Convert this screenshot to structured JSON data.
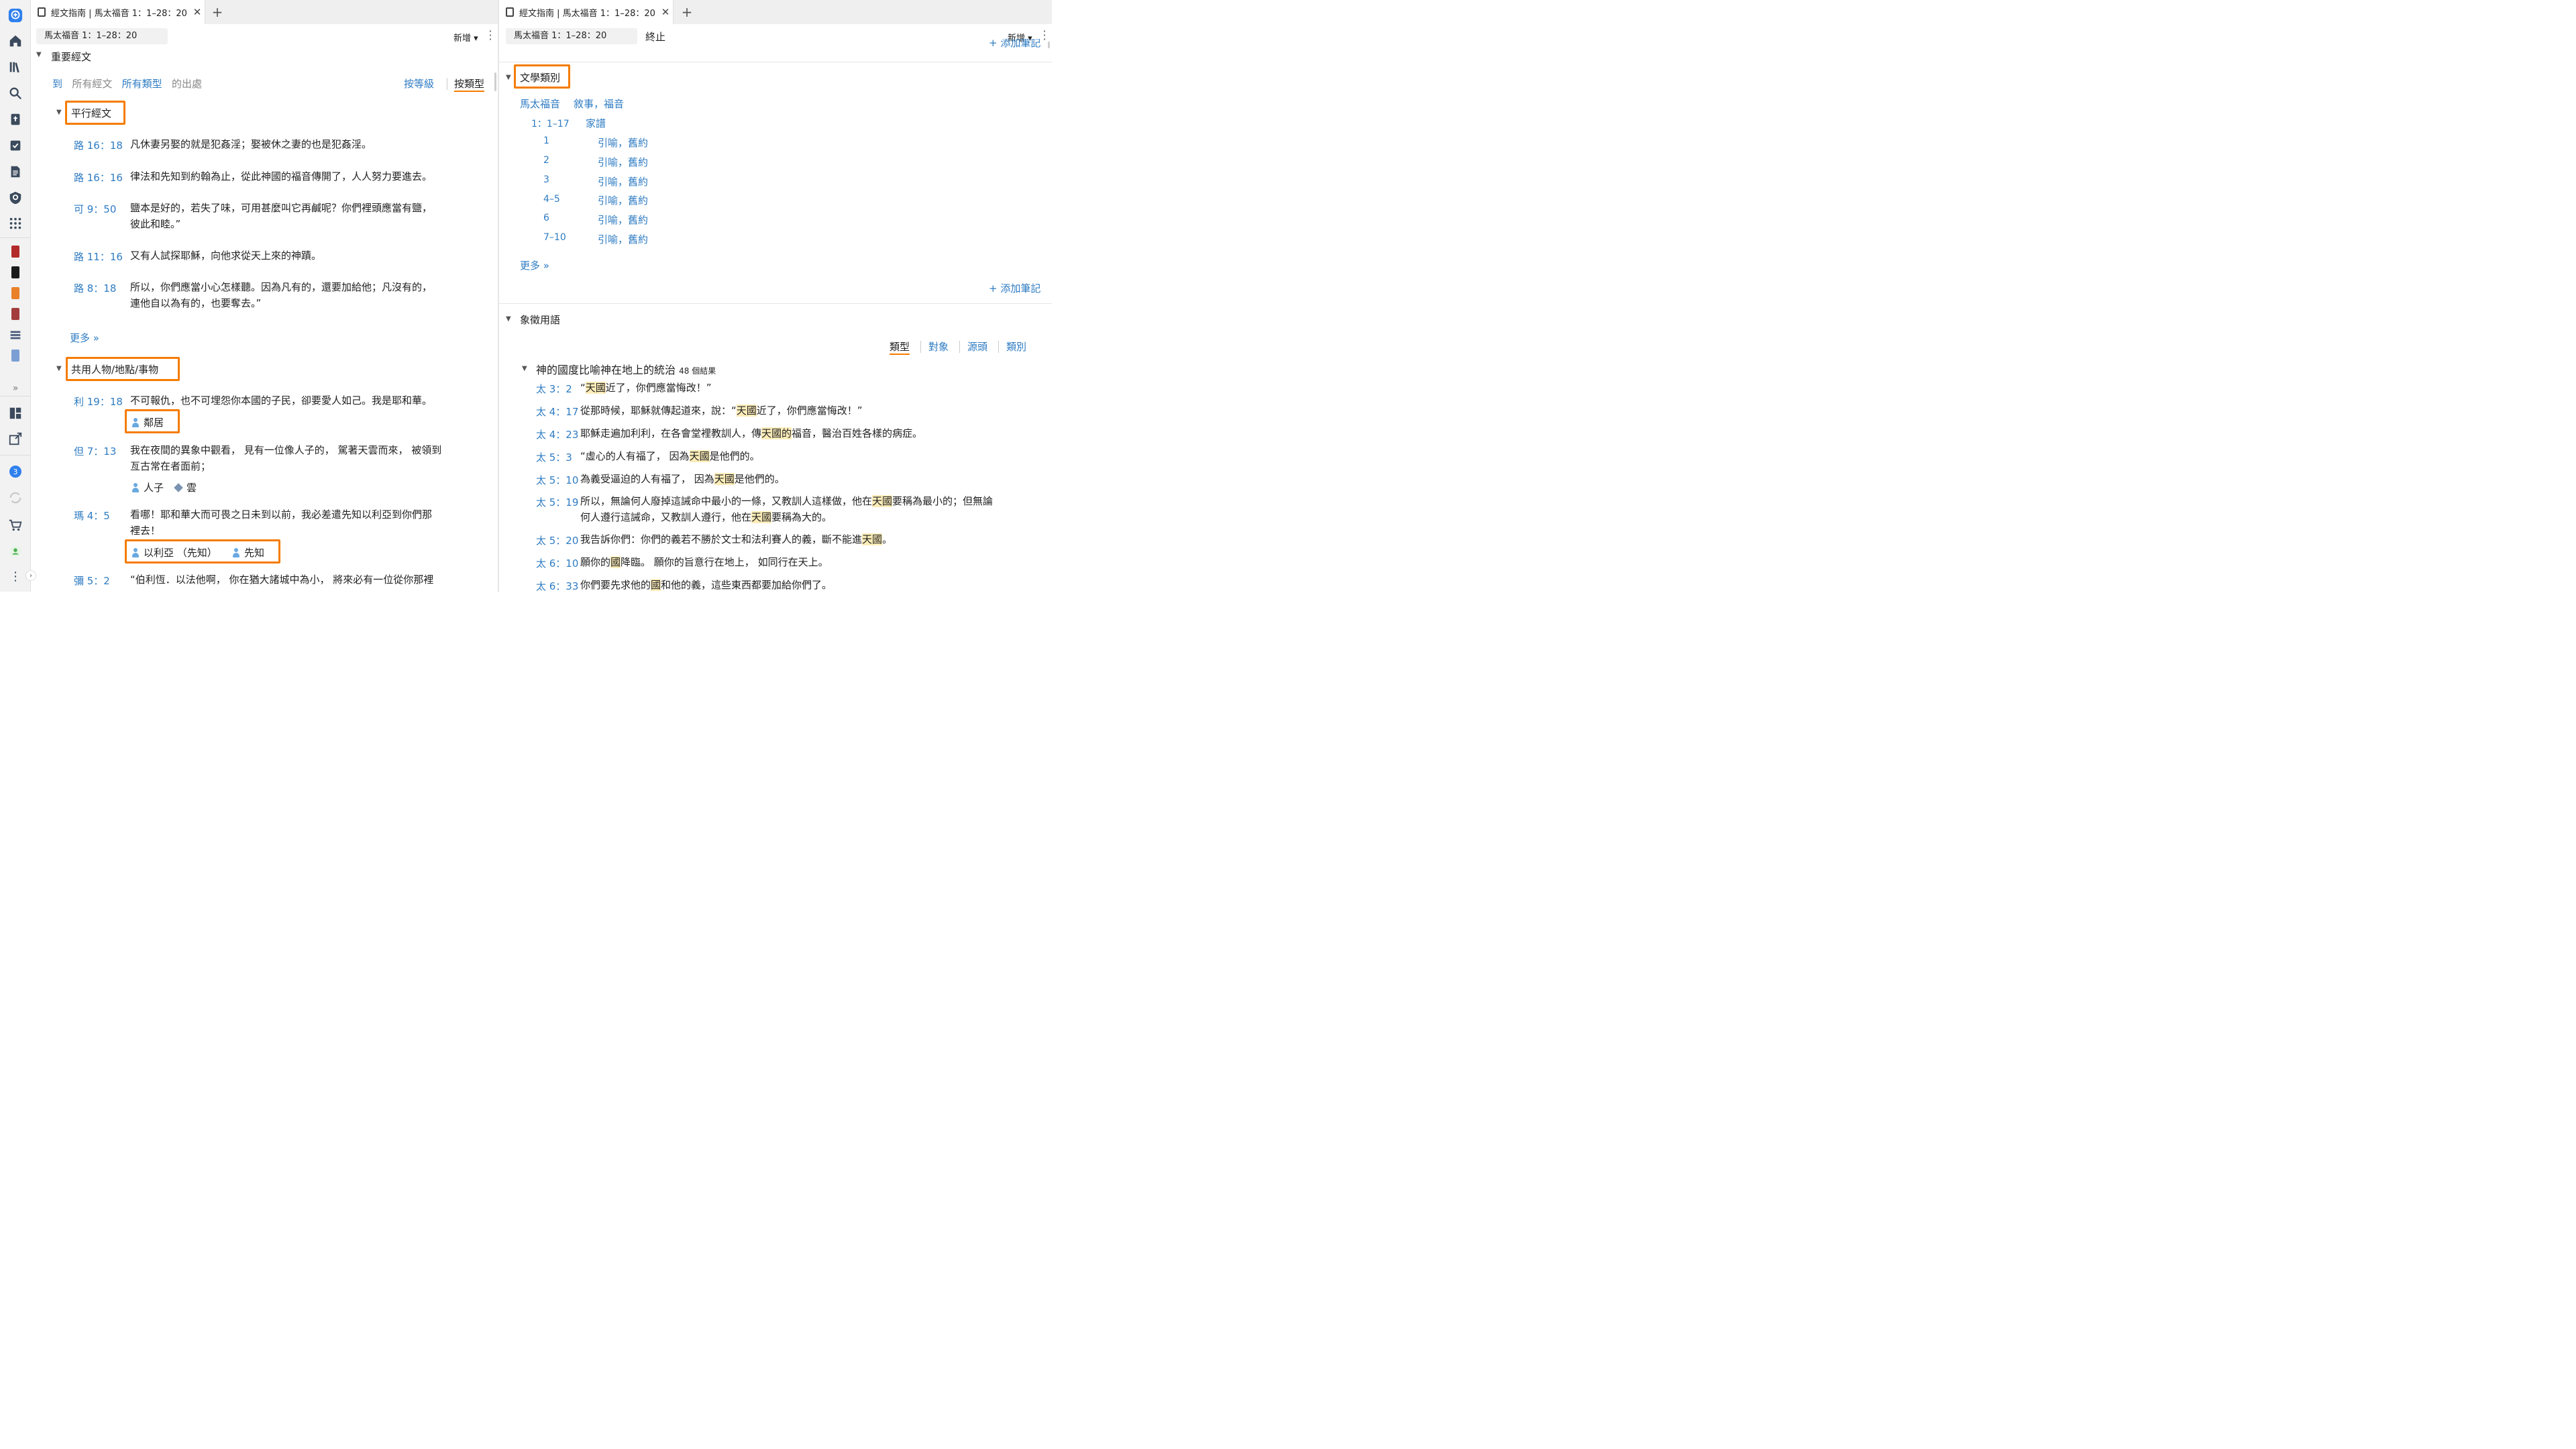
{
  "tabs": {
    "title": "經文指南 | 馬太福音 1：1–28：20"
  },
  "toolbar": {
    "ref": "馬太音 1：1–28：20",
    "ref_full": "馬太福音 1：1–28：20",
    "new_label": "新增",
    "stop_label": "終止"
  },
  "left": {
    "section_title": "重要經文",
    "filter": {
      "to": "到",
      "all_verses": "所有經文",
      "all_types": "所有類型",
      "of_places": "的出處",
      "by_rank": "按等級",
      "by_type": "按類型"
    },
    "parallel": {
      "title": "平行經文",
      "items": [
        {
          "ref": "路 16：18",
          "text": "凡休妻另娶的就是犯姦淫；娶被休之妻的也是犯姦淫。",
          "text2": ""
        },
        {
          "ref": "路 16：16",
          "text": "律法和先知到約翰為止，從此神國的福音傳開了，人人努力要進去。",
          "text2": ""
        },
        {
          "ref": "可 9：50",
          "text": "鹽本是好的，若失了味，可用甚麼叫它再鹹呢？你們裡頭應當有鹽，",
          "text2": "彼此和睦。”"
        },
        {
          "ref": "路 11：16",
          "text": "又有人試探耶穌，向他求從天上來的神蹟。",
          "text2": ""
        },
        {
          "ref": "路 8：18",
          "text": "所以，你們應當小心怎樣聽。因為凡有的，還要加給他；凡沒有的，",
          "text2": "連他自以為有的，也要奪去。”"
        }
      ],
      "more": "更多 »"
    },
    "shared": {
      "title": "共用人物/地點/事物",
      "items": [
        {
          "ref": "利 19：18",
          "text": "不可報仇，也不可埋怨你本國的子民，卻要愛人如己。我是耶和華。",
          "text2": "",
          "tags": [
            "鄰居"
          ]
        },
        {
          "ref": "但 7：13",
          "text": "我在夜間的異象中觀看， 見有一位像人子的， 駕著天雲而來， 被領到",
          "text2": "亙古常在者面前；",
          "tags": [
            "人子",
            "雲"
          ]
        },
        {
          "ref": "瑪 4：5",
          "text": "看哪！耶和華大而可畏之日未到以前，我必差遣先知以利亞到你們那",
          "text2": "裡去！",
          "tags": [
            "以利亞 （先知）",
            "先知"
          ]
        },
        {
          "ref": "彌 5：2",
          "text": "“伯利恆．以法他啊， 你在猶大諸城中為小， 將來必有一位從你那裡",
          "text2": "",
          "tags": []
        }
      ]
    }
  },
  "right": {
    "add_note_top": "+ 添加筆記",
    "literary": {
      "title": "文學類別",
      "book": "馬太福音",
      "book_genre": "敘事，福音",
      "range": "1：1–17",
      "range_genre": "家譜",
      "rows": [
        {
          "v": "1",
          "g": "引喻，舊約"
        },
        {
          "v": "2",
          "g": "引喻，舊約"
        },
        {
          "v": "3",
          "g": "引喻，舊約"
        },
        {
          "v": "4–5",
          "g": "引喻，舊約"
        },
        {
          "v": "6",
          "g": "引喻，舊約"
        },
        {
          "v": "7–10",
          "g": "引喻，舊約"
        }
      ],
      "more": "更多 »",
      "add_note": "+ 添加筆記"
    },
    "symbolic": {
      "title": "象徵用語",
      "tabs": [
        "類型",
        "對象",
        "源頭",
        "類別"
      ],
      "group_title": "神的國度比喻神在地上的統治",
      "group_count": "48 個結果",
      "items": [
        {
          "ref": "太 3：2",
          "segs": [
            "“",
            "天國",
            "近了，你們應當悔改！”"
          ]
        },
        {
          "ref": "太 4：17",
          "segs": [
            "從那時候，耶穌就傳起道來，說：“",
            "天國",
            "近了，你們應當悔改！”"
          ]
        },
        {
          "ref": "太 4：23",
          "segs": [
            "耶穌走遍加利利，在各會堂裡教訓人，傳",
            "天國的",
            "福音，醫治百姓各樣的病症。"
          ]
        },
        {
          "ref": "太 5：3",
          "segs": [
            "“虛心的人有福了， 因為",
            "天國",
            "是他們的。"
          ]
        },
        {
          "ref": "太 5：10",
          "segs": [
            "為義受逼迫的人有福了， 因為",
            "天國",
            "是他們的。"
          ]
        },
        {
          "ref": "太 5：19",
          "segs": [
            "所以，無論何人廢掉這誡命中最小的一條，又教訓人這樣做，他在",
            "天國",
            "要稱為最小的；但無論"
          ],
          "line2": [
            "何人遵行這誡命，又教訓人遵行，他在",
            "天國",
            "要稱為大的。"
          ]
        },
        {
          "ref": "太 5：20",
          "segs": [
            "我告訴你們：你們的義若不勝於文士和法利賽人的義，斷不能進",
            "天國",
            "。"
          ]
        },
        {
          "ref": "太 6：10",
          "segs": [
            "願你的",
            "國",
            "降臨。 願你的旨意行在地上， 如同行在天上。"
          ]
        },
        {
          "ref": "太 6：33",
          "segs": [
            "你們要先求他的",
            "國",
            "和他的義，這些東西都要加給你們了。"
          ]
        }
      ]
    }
  },
  "sidebar": {
    "badge_count": "3",
    "expand": "»"
  },
  "colors": {
    "accent_blue": "#2f7cc3",
    "highlight_orange": "#f57c00",
    "mark_yellow": "#fbecb8"
  }
}
